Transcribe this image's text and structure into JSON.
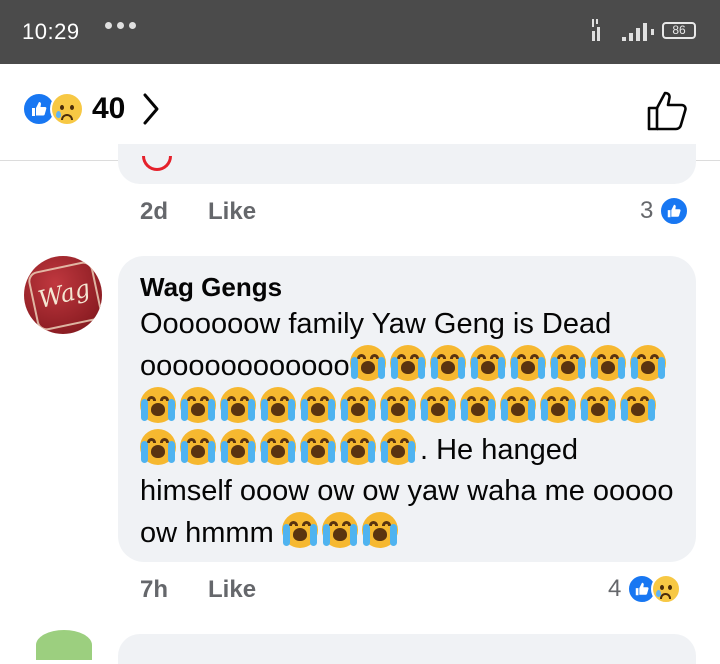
{
  "status_bar": {
    "time": "10:29",
    "battery": "86",
    "colors": {
      "background": "#4b4b4b"
    }
  },
  "reactions_header": {
    "count": "40",
    "icons": [
      "like-icon",
      "sad-icon",
      "chevron-right-icon",
      "thumbs-up-outline-icon"
    ]
  },
  "previous_comment": {
    "time": "2d",
    "like_label": "Like",
    "reaction_count": "3"
  },
  "comment": {
    "author": "Wag Gengs",
    "segments": [
      {
        "text": "Ooooooow family Yaw Geng is Dead ooooooooooooo",
        "emoji_after": 7
      },
      {
        "text": "",
        "emoji_after": 13
      },
      {
        "text": "",
        "emoji_after": 8
      },
      {
        "text": ". He hanged himself ooow ow ow yaw waha me ooooo ow hmmm ",
        "emoji_after": 3
      }
    ],
    "emoji_name": "loudly-crying-face-icon",
    "time": "7h",
    "like_label": "Like",
    "reaction_count": "4"
  },
  "colors": {
    "accent": "#1877f2",
    "bubble": "#f0f2f5",
    "meta_text": "#65676b"
  }
}
